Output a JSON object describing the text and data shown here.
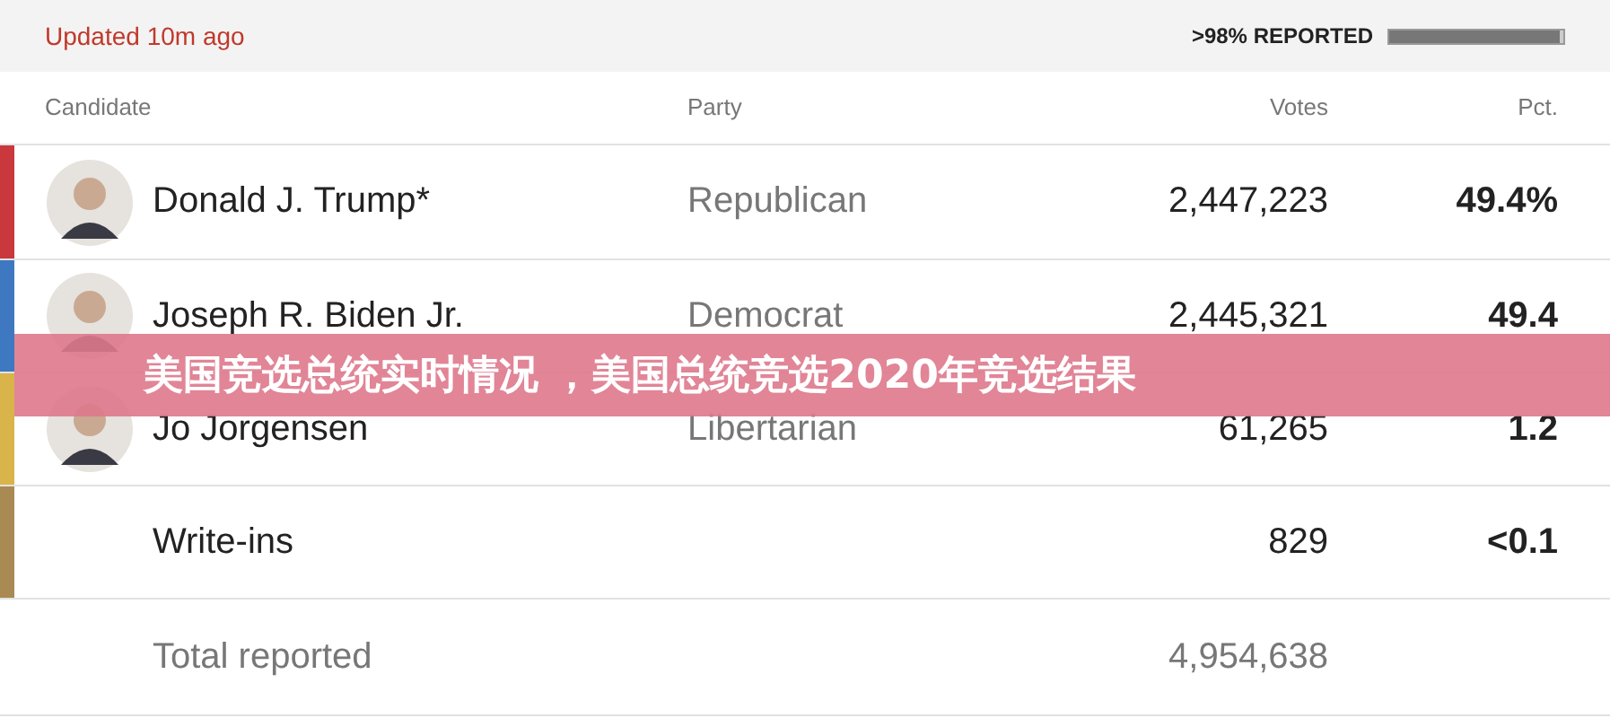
{
  "header": {
    "updated": "Updated 10m ago",
    "reported": ">98% REPORTED",
    "level": 0.98
  },
  "table": {
    "columns": [
      "Candidate",
      "Party",
      "Votes",
      "Pct."
    ],
    "rows": [
      {
        "kind": "candidate",
        "color": "#c8383c",
        "name": "Donald J. Trump*",
        "party": "Republican",
        "votes": "2,447,223",
        "pct": "49.4%"
      },
      {
        "kind": "candidate",
        "color": "#3e78c0",
        "name": "Joseph R. Biden Jr.",
        "party": "Democrat",
        "votes": "2,445,321",
        "pct": "49.4"
      },
      {
        "kind": "candidate",
        "color": "#d9b44a",
        "name": "Jo Jorgensen",
        "party": "Libertarian",
        "votes": "61,265",
        "pct": "1.2"
      },
      {
        "kind": "other",
        "color": "#a88a52",
        "name": "Write-ins",
        "votes": "829",
        "pct": "<0.1"
      },
      {
        "kind": "total",
        "name": "Total reported",
        "votes": "4,954,638"
      }
    ]
  },
  "banner": {
    "title": "美国竞选总统实时情况 ，美国总统竞选2020年竞选结果"
  }
}
